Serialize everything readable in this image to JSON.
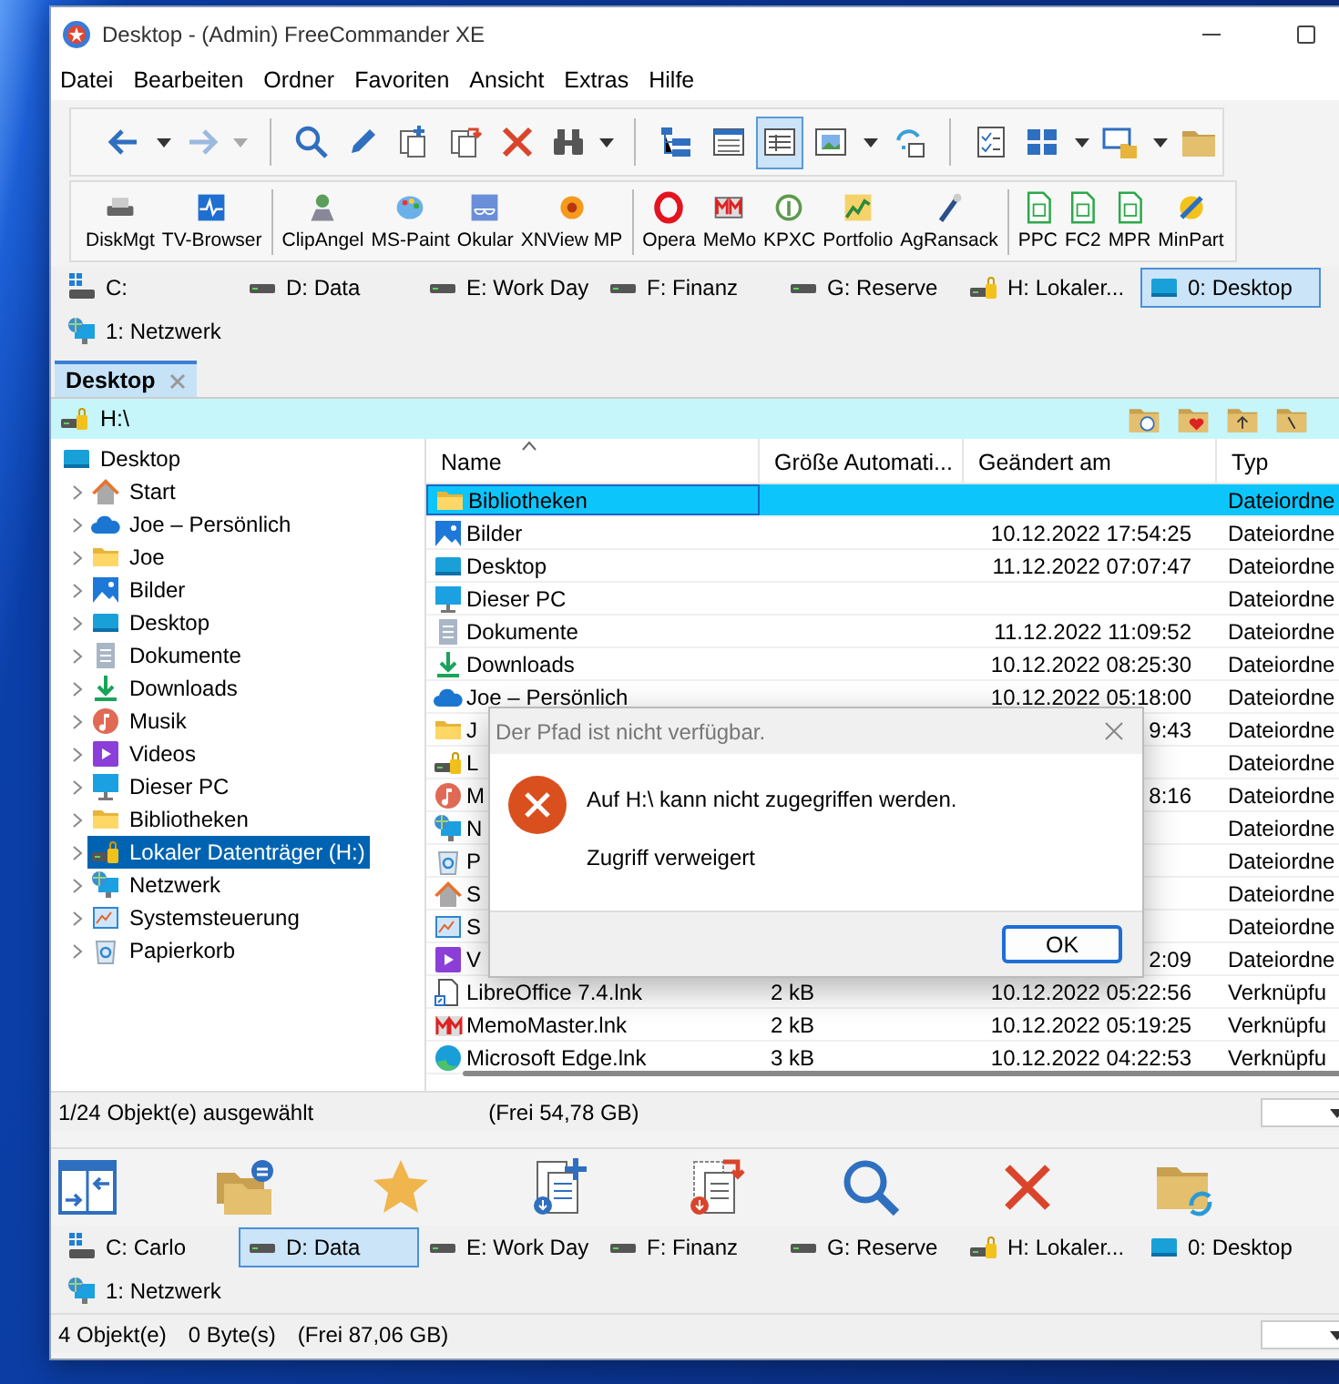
{
  "window": {
    "title": "Desktop - (Admin) FreeCommander XE"
  },
  "menu": [
    "Datei",
    "Bearbeiten",
    "Ordner",
    "Favoriten",
    "Ansicht",
    "Extras",
    "Hilfe"
  ],
  "toolbar": [
    {
      "selected": false,
      "disabled": false
    },
    {
      "selected": false,
      "disabled": true
    },
    {
      "selected": false,
      "disabled": false
    },
    {
      "selected": false,
      "disabled": false
    },
    {
      "selected": false,
      "disabled": false
    },
    {
      "selected": false,
      "disabled": false
    },
    {
      "selected": false,
      "disabled": false
    },
    {
      "selected": false,
      "disabled": false
    },
    {
      "selected": false,
      "disabled": false
    },
    {
      "selected": false,
      "disabled": false
    },
    {
      "selected": true,
      "disabled": false
    },
    {
      "selected": false,
      "disabled": false
    },
    {
      "selected": false,
      "disabled": false
    },
    {
      "selected": false,
      "disabled": false
    },
    {
      "selected": false,
      "disabled": false
    },
    {
      "selected": false,
      "disabled": false
    },
    {
      "selected": false,
      "disabled": false
    }
  ],
  "launchers": [
    "DiskMgt",
    "TV-Browser",
    "ClipAngel",
    "MS-Paint",
    "Okular",
    "XNView MP",
    "Opera",
    "MeMo",
    "KPXC",
    "Portfolio",
    "AgRansack",
    "PPC",
    "FC2",
    "MPR",
    "MinPart"
  ],
  "drives": [
    {
      "label": "C:",
      "kind": "system",
      "selected": false
    },
    {
      "label": "D: Data",
      "kind": "drive",
      "selected": false
    },
    {
      "label": "E: Work Day",
      "kind": "drive",
      "selected": false
    },
    {
      "label": "F: Finanz",
      "kind": "drive",
      "selected": false
    },
    {
      "label": "G: Reserve",
      "kind": "drive",
      "selected": false
    },
    {
      "label": "H: Lokaler...",
      "kind": "lockdrive",
      "selected": false
    },
    {
      "label": "0: Desktop",
      "kind": "desktop",
      "selected": true
    },
    {
      "label": "1: Netzwerk",
      "kind": "network",
      "selected": false
    }
  ],
  "tabs": [
    {
      "label": "Desktop",
      "selected": true
    }
  ],
  "path": "H:\\",
  "tree": {
    "label": "Desktop",
    "kind": "desktop",
    "selected": false,
    "children": [
      {
        "label": "Start",
        "kind": "home",
        "expanded": false,
        "selected": false
      },
      {
        "label": "Joe – Persönlich",
        "kind": "cloud",
        "expanded": false,
        "selected": false
      },
      {
        "label": "Joe",
        "kind": "folder",
        "expanded": false,
        "selected": false
      },
      {
        "label": "Bilder",
        "kind": "pictures",
        "expanded": false,
        "selected": false
      },
      {
        "label": "Desktop",
        "kind": "desktop",
        "expanded": false,
        "selected": false
      },
      {
        "label": "Dokumente",
        "kind": "documents",
        "expanded": false,
        "selected": false
      },
      {
        "label": "Downloads",
        "kind": "downloads",
        "expanded": false,
        "selected": false
      },
      {
        "label": "Musik",
        "kind": "music",
        "expanded": false,
        "selected": false
      },
      {
        "label": "Videos",
        "kind": "videos",
        "expanded": false,
        "selected": false
      },
      {
        "label": "Dieser PC",
        "kind": "pc",
        "expanded": false,
        "selected": false
      },
      {
        "label": "Bibliotheken",
        "kind": "folder",
        "expanded": false,
        "selected": false
      },
      {
        "label": "Lokaler Datenträger (H:)",
        "kind": "lockdrive",
        "expanded": false,
        "selected": true
      },
      {
        "label": "Netzwerk",
        "kind": "network",
        "expanded": false,
        "selected": false
      },
      {
        "label": "Systemsteuerung",
        "kind": "control",
        "expanded": false,
        "selected": false
      },
      {
        "label": "Papierkorb",
        "kind": "recycle",
        "expanded": false,
        "selected": false
      }
    ]
  },
  "table": {
    "columns": [
      "Name",
      "Größe Automati...",
      "Geändert am",
      "Typ"
    ],
    "rows": [
      {
        "name": "Bibliotheken",
        "kind": "folder",
        "type": "Dateiordne",
        "selected": true
      },
      {
        "name": "Bilder",
        "kind": "pictures",
        "modified": "10.12.2022 17:54:25",
        "type": "Dateiordne",
        "selected": false
      },
      {
        "name": "Desktop",
        "kind": "desktop",
        "modified": "11.12.2022 07:07:47",
        "type": "Dateiordne",
        "selected": false
      },
      {
        "name": "Dieser PC",
        "kind": "pc",
        "type": "Dateiordne",
        "selected": false
      },
      {
        "name": "Dokumente",
        "kind": "documents",
        "modified": "11.12.2022 11:09:52",
        "type": "Dateiordne",
        "selected": false
      },
      {
        "name": "Downloads",
        "kind": "downloads",
        "modified": "10.12.2022 08:25:30",
        "type": "Dateiordne",
        "selected": false
      },
      {
        "name": "Joe – Persönlich",
        "kind": "cloud",
        "modified": "10.12.2022 05:18:00",
        "type": "Dateiordne",
        "selected": false
      },
      {
        "name": "J",
        "kind": "folder",
        "modified": "9:43",
        "type": "Dateiordne",
        "selected": false
      },
      {
        "name": "L",
        "kind": "lockdrive",
        "type": "Dateiordne",
        "selected": false
      },
      {
        "name": "M",
        "kind": "music",
        "modified": "8:16",
        "type": "Dateiordne",
        "selected": false
      },
      {
        "name": "N",
        "kind": "network",
        "type": "Dateiordne",
        "selected": false
      },
      {
        "name": "P",
        "kind": "recycle",
        "type": "Dateiordne",
        "selected": false
      },
      {
        "name": "S",
        "kind": "home",
        "type": "Dateiordne",
        "selected": false
      },
      {
        "name": "S",
        "kind": "control",
        "type": "Dateiordne",
        "selected": false
      },
      {
        "name": "V",
        "kind": "videos",
        "modified": "2:09",
        "type": "Dateiordne",
        "selected": false
      },
      {
        "name": "LibreOffice 7.4.lnk",
        "kind": "shortcut",
        "size": "2 kB",
        "modified": "10.12.2022 05:22:56",
        "type": "Verknüpfu",
        "selected": false
      },
      {
        "name": "MemoMaster.lnk",
        "kind": "memo",
        "size": "2 kB",
        "modified": "10.12.2022 05:19:25",
        "type": "Verknüpfu",
        "selected": false
      },
      {
        "name": "Microsoft Edge.lnk",
        "kind": "edge",
        "size": "3 kB",
        "modified": "10.12.2022 04:22:53",
        "type": "Verknüpfu",
        "selected": false
      }
    ]
  },
  "status": [
    "1/24 Objekt(e) ausgewählt",
    "(Frei 54,78 GB)"
  ],
  "drives_bottom": [
    {
      "label": "C: Carlo",
      "kind": "system",
      "selected": false
    },
    {
      "label": "D: Data",
      "kind": "drive",
      "selected": true
    },
    {
      "label": "E: Work Day",
      "kind": "drive",
      "selected": false
    },
    {
      "label": "F: Finanz",
      "kind": "drive",
      "selected": false
    },
    {
      "label": "G: Reserve",
      "kind": "drive",
      "selected": false
    },
    {
      "label": "H: Lokaler...",
      "kind": "lockdrive",
      "selected": false
    },
    {
      "label": "0: Desktop",
      "kind": "desktop",
      "selected": false
    },
    {
      "label": "1: Netzwerk",
      "kind": "network",
      "selected": false
    }
  ],
  "status_bottom": [
    "4 Objekt(e)",
    "0 Byte(s)",
    "(Frei 87,06 GB)"
  ],
  "dialog": {
    "title": "Der Pfad ist nicht verfügbar.",
    "message": "Auf H:\\ kann nicht zugegriffen werden.",
    "detail": "Zugriff verweigert",
    "button": "OK"
  }
}
